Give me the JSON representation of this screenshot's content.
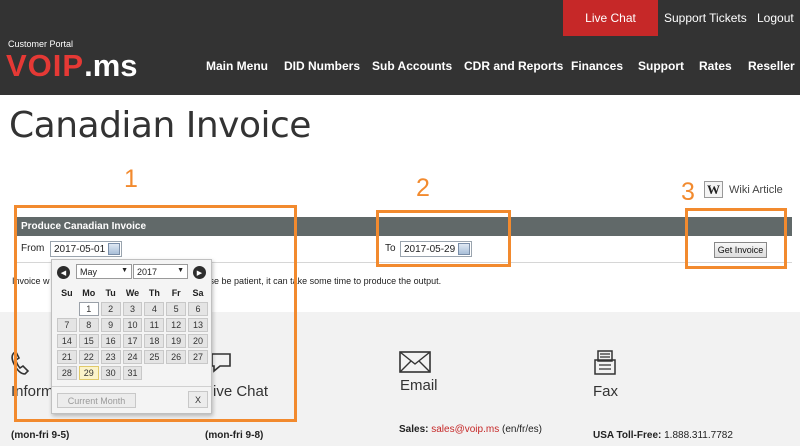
{
  "header": {
    "live_chat": "Live Chat",
    "support_tickets": "Support Tickets",
    "logout": "Logout",
    "portal_label": "Customer Portal",
    "logo_main": "VOIP",
    "logo_ext": ".ms",
    "nav": [
      "Main Menu",
      "DID Numbers",
      "Sub Accounts",
      "CDR and Reports",
      "Finances",
      "Support",
      "Rates",
      "Reseller"
    ]
  },
  "page": {
    "title": "Canadian Invoice",
    "wiki_icon": "W",
    "wiki_label": "Wiki Article"
  },
  "form": {
    "heading": "Produce Canadian Invoice",
    "from_label": "From",
    "from_value": "2017-05-01",
    "to_label": "To",
    "to_value": "2017-05-29",
    "button": "Get Invoice",
    "note_start": "Invoice w",
    "note_end": "ase be patient, it can take some time to produce the output."
  },
  "calendar": {
    "month": "May",
    "year": "2017",
    "weekdays": [
      "Su",
      "Mo",
      "Tu",
      "We",
      "Th",
      "Fr",
      "Sa"
    ],
    "weeks": [
      [
        "",
        "1",
        "2",
        "3",
        "4",
        "5",
        "6"
      ],
      [
        "7",
        "8",
        "9",
        "10",
        "11",
        "12",
        "13"
      ],
      [
        "14",
        "15",
        "16",
        "17",
        "18",
        "19",
        "20"
      ],
      [
        "21",
        "22",
        "23",
        "24",
        "25",
        "26",
        "27"
      ],
      [
        "28",
        "29",
        "30",
        "31",
        "",
        "",
        ""
      ]
    ],
    "selected_day": "1",
    "today_day": "29",
    "current_month_button": "Current Month",
    "close_button": "X"
  },
  "contact": {
    "phone_title": "Inform",
    "phone_hours": "(mon-fri 9-5)",
    "chat_title": "ive Chat",
    "chat_hours": "(mon-fri 9-8)",
    "email_title": "Email",
    "email_label": "Sales:",
    "email_address": "sales@voip.ms",
    "email_langs": "(en/fr/es)",
    "fax_title": "Fax",
    "fax_label": "USA Toll-Free:",
    "fax_number": "1.888.311.7782"
  },
  "annotations": [
    "1",
    "2",
    "3"
  ],
  "colors": {
    "header_bg": "#333333",
    "brand_red": "#c62828",
    "annotation_orange": "#f28a2e",
    "panel_head": "#616969"
  }
}
